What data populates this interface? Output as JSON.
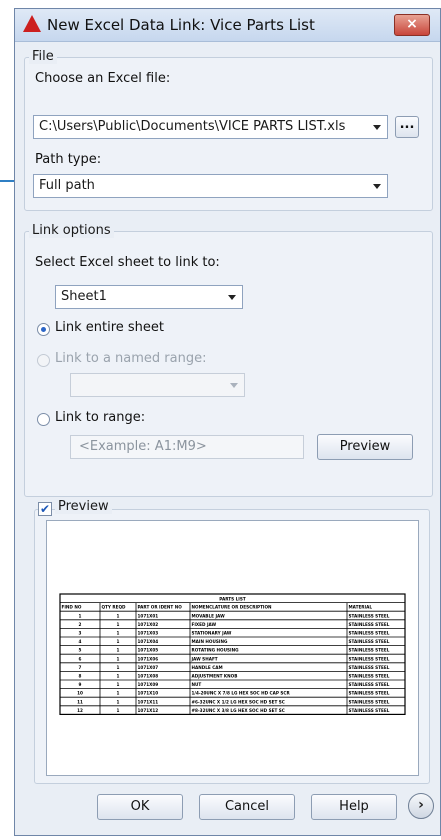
{
  "window": {
    "title": "New Excel Data Link: Vice Parts List",
    "close_label": "×"
  },
  "file_group": {
    "legend": "File",
    "choose_label": "Choose an Excel file:",
    "file_path": "C:\\Users\\Public\\Documents\\VICE PARTS LIST.xls",
    "browse_label": "...",
    "path_type_label": "Path type:",
    "path_type_value": "Full path"
  },
  "link_options": {
    "legend": "Link options",
    "sheet_label": "Select Excel sheet to link to:",
    "sheet_value": "Sheet1",
    "entire_sheet_label": "Link entire sheet",
    "named_range_label": "Link to a named range:",
    "named_range_value": "",
    "range_label": "Link to range:",
    "range_placeholder": "<Example: A1:M9>",
    "preview_button": "Preview"
  },
  "preview_group": {
    "checkbox_label": "Preview",
    "checked": true,
    "table": {
      "title": "PARTS LIST",
      "headers": [
        "FIND NO",
        "QTY REQD",
        "PART OR IDENT NO",
        "NOMENCLATURE OR DESCRIPTION",
        "MATERIAL"
      ],
      "rows": [
        [
          "1",
          "1",
          "1071X01",
          "MOVABLE JAW",
          "STAINLESS STEEL"
        ],
        [
          "2",
          "1",
          "1071X02",
          "FIXED JAW",
          "STAINLESS STEEL"
        ],
        [
          "3",
          "1",
          "1071X03",
          "STATIONARY JAW",
          "STAINLESS STEEL"
        ],
        [
          "4",
          "1",
          "1071X04",
          "MAIN HOUSING",
          "STAINLESS STEEL"
        ],
        [
          "5",
          "1",
          "1071X05",
          "ROTATING HOUSING",
          "STAINLESS STEEL"
        ],
        [
          "6",
          "1",
          "1071X06",
          "JAW SHAFT",
          "STAINLESS STEEL"
        ],
        [
          "7",
          "1",
          "1071X07",
          "HANDLE CAM",
          "STAINLESS STEEL"
        ],
        [
          "8",
          "1",
          "1071X08",
          "ADJUSTMENT KNOB",
          "STAINLESS STEEL"
        ],
        [
          "9",
          "1",
          "1071X09",
          "NUT",
          "STAINLESS STEEL"
        ],
        [
          "10",
          "1",
          "1071X10",
          "1/4-20UNC X 7/8 LG HEX SOC HD CAP SCR",
          "STAINLESS STEEL"
        ],
        [
          "11",
          "1",
          "1071X11",
          "#6-32UNC X 1/2 LG HEX SOC HD SET SC",
          "STAINLESS STEEL"
        ],
        [
          "12",
          "1",
          "1071X12",
          "#8-32UNC X 3/8 LG HEX SOC HD SET SC",
          "STAINLESS STEEL"
        ]
      ]
    }
  },
  "footer": {
    "ok": "OK",
    "cancel": "Cancel",
    "help": "Help",
    "next_symbol": "›"
  },
  "colors": {
    "callout": "#2f7fc4",
    "accent_icon": "#cc1f1f"
  }
}
